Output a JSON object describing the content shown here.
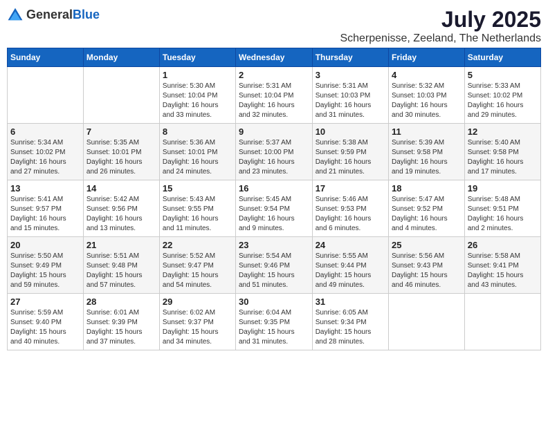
{
  "logo": {
    "general": "General",
    "blue": "Blue"
  },
  "title": {
    "month": "July 2025",
    "location": "Scherpenisse, Zeeland, The Netherlands"
  },
  "days_of_week": [
    "Sunday",
    "Monday",
    "Tuesday",
    "Wednesday",
    "Thursday",
    "Friday",
    "Saturday"
  ],
  "weeks": [
    [
      {
        "day": "",
        "info": ""
      },
      {
        "day": "",
        "info": ""
      },
      {
        "day": "1",
        "info": "Sunrise: 5:30 AM\nSunset: 10:04 PM\nDaylight: 16 hours\nand 33 minutes."
      },
      {
        "day": "2",
        "info": "Sunrise: 5:31 AM\nSunset: 10:04 PM\nDaylight: 16 hours\nand 32 minutes."
      },
      {
        "day": "3",
        "info": "Sunrise: 5:31 AM\nSunset: 10:03 PM\nDaylight: 16 hours\nand 31 minutes."
      },
      {
        "day": "4",
        "info": "Sunrise: 5:32 AM\nSunset: 10:03 PM\nDaylight: 16 hours\nand 30 minutes."
      },
      {
        "day": "5",
        "info": "Sunrise: 5:33 AM\nSunset: 10:02 PM\nDaylight: 16 hours\nand 29 minutes."
      }
    ],
    [
      {
        "day": "6",
        "info": "Sunrise: 5:34 AM\nSunset: 10:02 PM\nDaylight: 16 hours\nand 27 minutes."
      },
      {
        "day": "7",
        "info": "Sunrise: 5:35 AM\nSunset: 10:01 PM\nDaylight: 16 hours\nand 26 minutes."
      },
      {
        "day": "8",
        "info": "Sunrise: 5:36 AM\nSunset: 10:01 PM\nDaylight: 16 hours\nand 24 minutes."
      },
      {
        "day": "9",
        "info": "Sunrise: 5:37 AM\nSunset: 10:00 PM\nDaylight: 16 hours\nand 23 minutes."
      },
      {
        "day": "10",
        "info": "Sunrise: 5:38 AM\nSunset: 9:59 PM\nDaylight: 16 hours\nand 21 minutes."
      },
      {
        "day": "11",
        "info": "Sunrise: 5:39 AM\nSunset: 9:58 PM\nDaylight: 16 hours\nand 19 minutes."
      },
      {
        "day": "12",
        "info": "Sunrise: 5:40 AM\nSunset: 9:58 PM\nDaylight: 16 hours\nand 17 minutes."
      }
    ],
    [
      {
        "day": "13",
        "info": "Sunrise: 5:41 AM\nSunset: 9:57 PM\nDaylight: 16 hours\nand 15 minutes."
      },
      {
        "day": "14",
        "info": "Sunrise: 5:42 AM\nSunset: 9:56 PM\nDaylight: 16 hours\nand 13 minutes."
      },
      {
        "day": "15",
        "info": "Sunrise: 5:43 AM\nSunset: 9:55 PM\nDaylight: 16 hours\nand 11 minutes."
      },
      {
        "day": "16",
        "info": "Sunrise: 5:45 AM\nSunset: 9:54 PM\nDaylight: 16 hours\nand 9 minutes."
      },
      {
        "day": "17",
        "info": "Sunrise: 5:46 AM\nSunset: 9:53 PM\nDaylight: 16 hours\nand 6 minutes."
      },
      {
        "day": "18",
        "info": "Sunrise: 5:47 AM\nSunset: 9:52 PM\nDaylight: 16 hours\nand 4 minutes."
      },
      {
        "day": "19",
        "info": "Sunrise: 5:48 AM\nSunset: 9:51 PM\nDaylight: 16 hours\nand 2 minutes."
      }
    ],
    [
      {
        "day": "20",
        "info": "Sunrise: 5:50 AM\nSunset: 9:49 PM\nDaylight: 15 hours\nand 59 minutes."
      },
      {
        "day": "21",
        "info": "Sunrise: 5:51 AM\nSunset: 9:48 PM\nDaylight: 15 hours\nand 57 minutes."
      },
      {
        "day": "22",
        "info": "Sunrise: 5:52 AM\nSunset: 9:47 PM\nDaylight: 15 hours\nand 54 minutes."
      },
      {
        "day": "23",
        "info": "Sunrise: 5:54 AM\nSunset: 9:46 PM\nDaylight: 15 hours\nand 51 minutes."
      },
      {
        "day": "24",
        "info": "Sunrise: 5:55 AM\nSunset: 9:44 PM\nDaylight: 15 hours\nand 49 minutes."
      },
      {
        "day": "25",
        "info": "Sunrise: 5:56 AM\nSunset: 9:43 PM\nDaylight: 15 hours\nand 46 minutes."
      },
      {
        "day": "26",
        "info": "Sunrise: 5:58 AM\nSunset: 9:41 PM\nDaylight: 15 hours\nand 43 minutes."
      }
    ],
    [
      {
        "day": "27",
        "info": "Sunrise: 5:59 AM\nSunset: 9:40 PM\nDaylight: 15 hours\nand 40 minutes."
      },
      {
        "day": "28",
        "info": "Sunrise: 6:01 AM\nSunset: 9:39 PM\nDaylight: 15 hours\nand 37 minutes."
      },
      {
        "day": "29",
        "info": "Sunrise: 6:02 AM\nSunset: 9:37 PM\nDaylight: 15 hours\nand 34 minutes."
      },
      {
        "day": "30",
        "info": "Sunrise: 6:04 AM\nSunset: 9:35 PM\nDaylight: 15 hours\nand 31 minutes."
      },
      {
        "day": "31",
        "info": "Sunrise: 6:05 AM\nSunset: 9:34 PM\nDaylight: 15 hours\nand 28 minutes."
      },
      {
        "day": "",
        "info": ""
      },
      {
        "day": "",
        "info": ""
      }
    ]
  ]
}
